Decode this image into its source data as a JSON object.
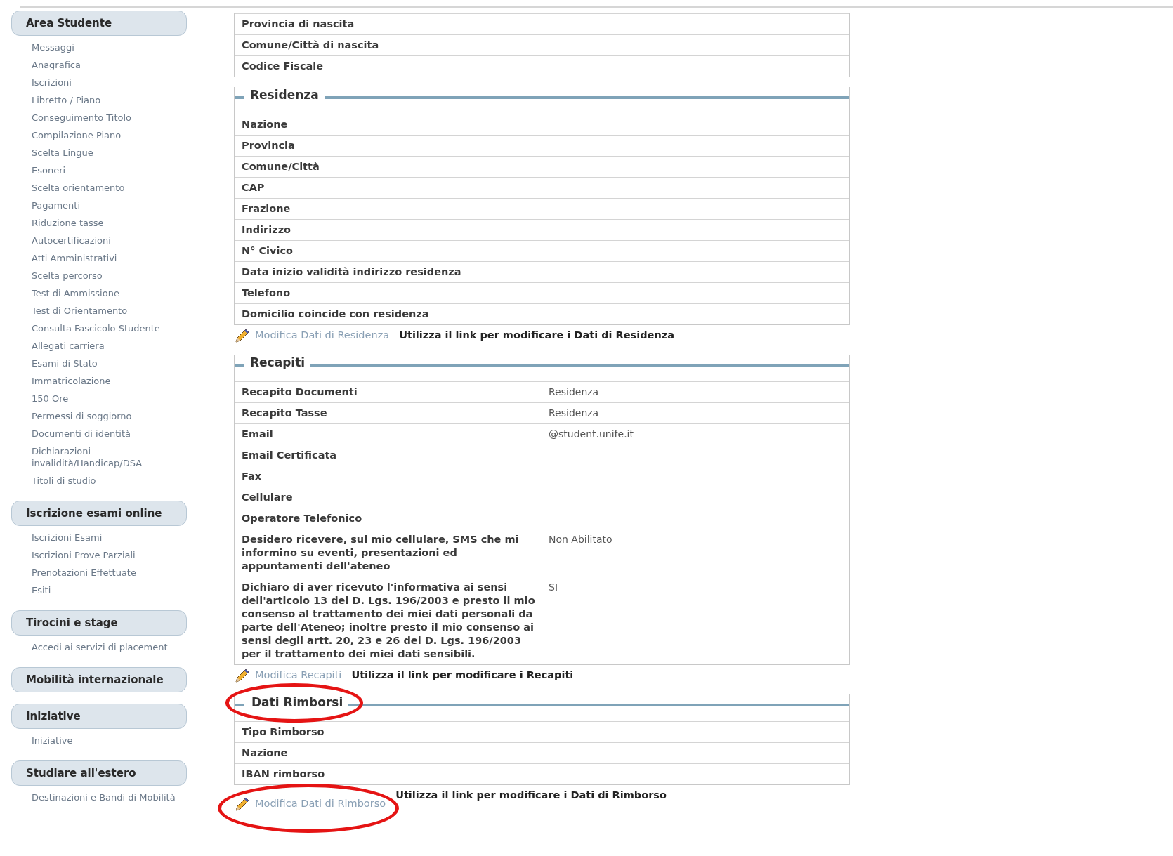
{
  "sidebar": {
    "sections": [
      {
        "title": "Area Studente",
        "items": [
          "Messaggi",
          "Anagrafica",
          "Iscrizioni",
          "Libretto / Piano",
          "Conseguimento Titolo",
          "Compilazione Piano",
          "Scelta Lingue",
          "Esoneri",
          "Scelta orientamento",
          "Pagamenti",
          "Riduzione tasse",
          "Autocertificazioni",
          "Atti Amministrativi",
          "Scelta percorso",
          "Test di Ammissione",
          "Test di Orientamento",
          "Consulta Fascicolo Studente",
          "Allegati carriera",
          "Esami di Stato",
          "Immatricolazione",
          "150 Ore",
          "Permessi di soggiorno",
          "Documenti di identità",
          "Dichiarazioni invalidità/Handicap/DSA",
          "Titoli di studio"
        ]
      },
      {
        "title": "Iscrizione esami online",
        "items": [
          "Iscrizioni Esami",
          "Iscrizioni Prove Parziali",
          "Prenotazioni Effettuate",
          "Esiti"
        ]
      },
      {
        "title": "Tirocini e stage",
        "items": [
          "Accedi ai servizi di placement"
        ]
      },
      {
        "title": "Mobilità internazionale"
      },
      {
        "title": "Iniziative",
        "items": [
          "Iniziative"
        ]
      },
      {
        "title": "Studiare all'estero",
        "items": [
          "Destinazioni e Bandi di Mobilità"
        ]
      }
    ]
  },
  "top_fieldset": {
    "rows": [
      {
        "label": "Provincia di nascita"
      },
      {
        "label": "Comune/Città di nascita"
      },
      {
        "label": "Codice Fiscale"
      }
    ]
  },
  "sections": [
    {
      "title": "Residenza",
      "highlighted": false,
      "rows": [
        {
          "label": "Nazione"
        },
        {
          "label": "Provincia"
        },
        {
          "label": "Comune/Città"
        },
        {
          "label": "CAP"
        },
        {
          "label": "Frazione"
        },
        {
          "label": "Indirizzo"
        },
        {
          "label": "N° Civico"
        },
        {
          "label": "Data inizio validità indirizzo residenza"
        },
        {
          "label": "Telefono"
        },
        {
          "label": "Domicilio coincide con residenza"
        }
      ],
      "edit": {
        "link": "Modifica Dati di Residenza",
        "note": "Utilizza il link per modificare i Dati di Residenza",
        "highlighted": false
      }
    },
    {
      "title": "Recapiti",
      "highlighted": false,
      "rows": [
        {
          "label": "Recapito Documenti",
          "value": "Residenza"
        },
        {
          "label": "Recapito Tasse",
          "value": "Residenza"
        },
        {
          "label": "Email",
          "value": "@student.unife.it"
        },
        {
          "label": "Email Certificata"
        },
        {
          "label": "Fax"
        },
        {
          "label": "Cellulare"
        },
        {
          "label": "Operatore Telefonico"
        },
        {
          "label": "Desidero ricevere, sul mio cellulare, SMS che mi informino su eventi, presentazioni ed appuntamenti dell'ateneo",
          "value": "Non Abilitato"
        },
        {
          "label": "Dichiaro di aver ricevuto l'informativa ai sensi dell'articolo 13 del D. Lgs. 196/2003 e presto il mio consenso al trattamento dei miei dati personali da parte dell'Ateneo; inoltre presto il mio consenso ai sensi degli artt. 20, 23 e 26 del D. Lgs. 196/2003 per il trattamento dei miei dati sensibili.",
          "value": "SI"
        }
      ],
      "edit": {
        "link": "Modifica Recapiti",
        "note": "Utilizza il link per modificare i Recapiti",
        "highlighted": false
      }
    },
    {
      "title": "Dati Rimborsi",
      "highlighted": true,
      "rows": [
        {
          "label": "Tipo Rimborso"
        },
        {
          "label": "Nazione"
        },
        {
          "label": "IBAN rimborso"
        }
      ],
      "edit": {
        "link": "Modifica Dati di Rimborso",
        "note": "Utilizza il link per modificare i Dati di Rimborso",
        "highlighted": true
      }
    }
  ]
}
